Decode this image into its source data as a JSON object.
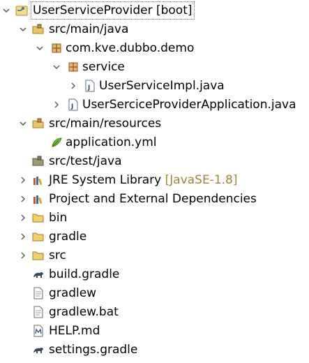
{
  "tree": {
    "root": {
      "label": "UserServiceProvider [boot]",
      "icon": "gradle-project-icon",
      "expanded": true
    },
    "src_main_java": {
      "label": "src/main/java",
      "icon": "source-folder-icon",
      "expanded": true
    },
    "package": {
      "label": "com.kve.dubbo.demo",
      "icon": "package-icon",
      "expanded": true
    },
    "service": {
      "label": "service",
      "icon": "package-icon",
      "expanded": true
    },
    "impl": {
      "label": "UserServiceImpl.java",
      "icon": "java-file-icon",
      "expanded": false
    },
    "app": {
      "label": "UserSerciceProviderApplication.java",
      "icon": "java-file-icon",
      "expanded": false
    },
    "src_main_resources": {
      "label": "src/main/resources",
      "icon": "source-folder-icon",
      "expanded": true
    },
    "application_yml": {
      "label": "application.yml",
      "icon": "yaml-file-icon"
    },
    "src_test_java": {
      "label": "src/test/java",
      "icon": "source-folder-icon"
    },
    "jre": {
      "label": "JRE System Library",
      "decoration": "[JavaSE-1.8]",
      "icon": "library-icon",
      "expanded": false
    },
    "deps": {
      "label": "Project and External Dependencies",
      "icon": "library-icon",
      "expanded": false
    },
    "bin": {
      "label": "bin",
      "icon": "folder-icon",
      "expanded": false
    },
    "gradle": {
      "label": "gradle",
      "icon": "folder-icon",
      "expanded": false
    },
    "src": {
      "label": "src",
      "icon": "folder-icon",
      "expanded": false
    },
    "build_gradle": {
      "label": "build.gradle",
      "icon": "gradle-file-icon"
    },
    "gradlew": {
      "label": "gradlew",
      "icon": "file-icon"
    },
    "gradlew_bat": {
      "label": "gradlew.bat",
      "icon": "file-icon"
    },
    "help_md": {
      "label": "HELP.md",
      "icon": "markdown-file-icon"
    },
    "settings_gradle": {
      "label": "settings.gradle",
      "icon": "gradle-file-icon"
    }
  },
  "colors": {
    "decoration": "#a0843e",
    "selection_border": "#6a6a6a"
  }
}
